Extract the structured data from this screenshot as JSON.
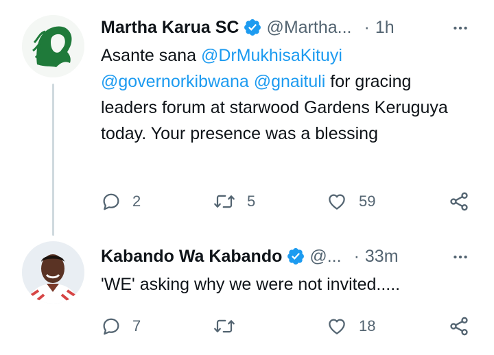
{
  "tweets": [
    {
      "author": "Martha Karua SC",
      "handle": "@Martha...",
      "separator": "·",
      "time": "1h",
      "text_before": "Asante sana ",
      "mention_1": "@DrMukhisaKituyi",
      "mention_2": "@governorkibwana",
      "mention_3": "@gnaituli",
      "text_after": " for gracing leaders forum at starwood Gardens Keruguya today. Your presence was a blessing",
      "replies": "2",
      "retweets": "5",
      "likes": "59"
    },
    {
      "author": "Kabando Wa Kabando",
      "handle": "@...",
      "separator": "·",
      "time": "33m",
      "text": "'WE' asking why we were not invited.....",
      "replies": "7",
      "retweets": "",
      "likes": "18"
    }
  ],
  "colors": {
    "accent": "#1d9bf0",
    "text": "#0f1419",
    "secondary": "#536471",
    "thread_line": "#cfd9de"
  },
  "icons": [
    "verified-badge-icon",
    "more-icon",
    "reply-icon",
    "retweet-icon",
    "like-icon",
    "share-icon"
  ]
}
